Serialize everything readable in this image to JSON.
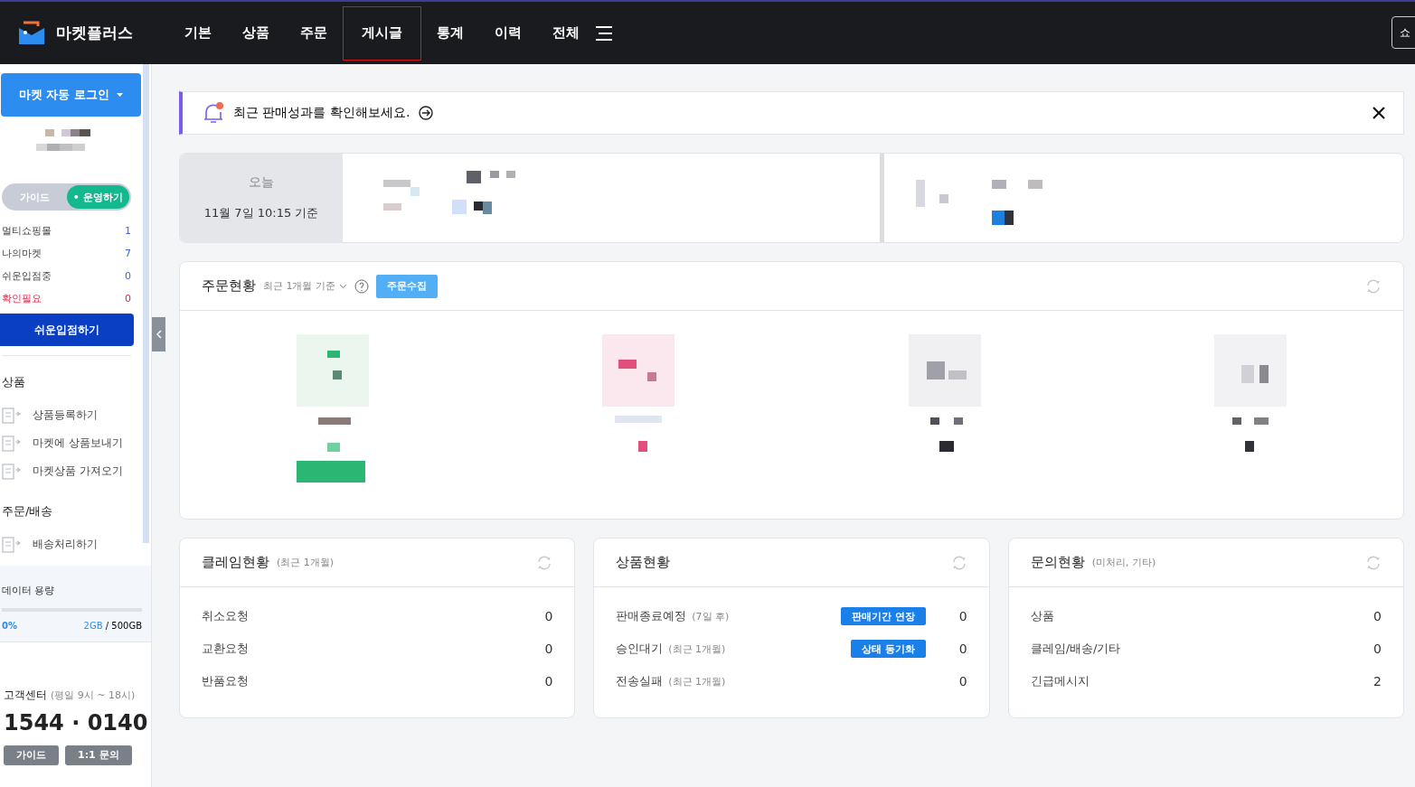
{
  "header": {
    "brand": "마켓플러스",
    "nav": [
      {
        "label": "기본",
        "highlighted": false
      },
      {
        "label": "상품",
        "highlighted": false
      },
      {
        "label": "주문",
        "highlighted": false
      },
      {
        "label": "게시글",
        "highlighted": true
      },
      {
        "label": "통계",
        "highlighted": false
      },
      {
        "label": "이력",
        "highlighted": false
      },
      {
        "label": "전체",
        "highlighted": false
      }
    ],
    "edge_button": "쇼"
  },
  "sidebar": {
    "login_button": "마켓 자동 로그인",
    "mode_toggle": [
      {
        "label": "가이드",
        "selected": false
      },
      {
        "label": "• 운영하기",
        "selected": true
      }
    ],
    "stats": [
      {
        "label": "멀티쇼핑몰",
        "value": "1",
        "alert": false
      },
      {
        "label": "나의마켓",
        "value": "7",
        "alert": false
      },
      {
        "label": "쉬운입점중",
        "value": "0",
        "alert": false
      },
      {
        "label": "확인필요",
        "value": "0",
        "alert": true
      }
    ],
    "action_button": "쉬운입점하기",
    "sections": [
      {
        "title": "상품",
        "items": [
          "상품등록하기",
          "마켓에 상품보내기",
          "마켓상품 가져오기"
        ]
      },
      {
        "title": "주문/배송",
        "items": [
          "배송처리하기"
        ]
      }
    ],
    "storage": {
      "title": "데이터 용량",
      "percent": "0%",
      "level": 0,
      "used": "2GB",
      "total": " / 500GB"
    },
    "support": {
      "title": "고객센터",
      "hours": "(평일 9시 ~ 18시)",
      "phone": "1544 · 0140",
      "buttons": [
        "가이드",
        "1:1 문의"
      ]
    }
  },
  "notice": {
    "text": "최근 판매성과를 확인해보세요."
  },
  "today": {
    "label": "오늘",
    "time": "11월 7일 10:15 기준"
  },
  "orders": {
    "title": "주문현황",
    "period": "최근 1개월 기준",
    "button": "주문수집"
  },
  "panels": [
    {
      "title": "클레임현황",
      "note": "(최근 1개월)",
      "rows": [
        {
          "label": "취소요청",
          "value": "0"
        },
        {
          "label": "교환요청",
          "value": "0"
        },
        {
          "label": "반품요청",
          "value": "0"
        }
      ]
    },
    {
      "title": "상품현황",
      "rows": [
        {
          "label": "판매종료예정",
          "note": "(7일 후)",
          "action": "판매기간 연장",
          "value": "0"
        },
        {
          "label": "승인대기",
          "note": "(최근 1개월)",
          "action": "상태 동기화",
          "value": "0"
        },
        {
          "label": "전송실패",
          "note": "(최근 1개월)",
          "value": "0"
        }
      ]
    },
    {
      "title": "문의현황",
      "note": "(미처리, 기타)",
      "rows": [
        {
          "label": "상품",
          "value": "0"
        },
        {
          "label": "클레임/배송/기타",
          "value": "0"
        },
        {
          "label": "긴급메시지",
          "value": "2"
        }
      ]
    }
  ]
}
